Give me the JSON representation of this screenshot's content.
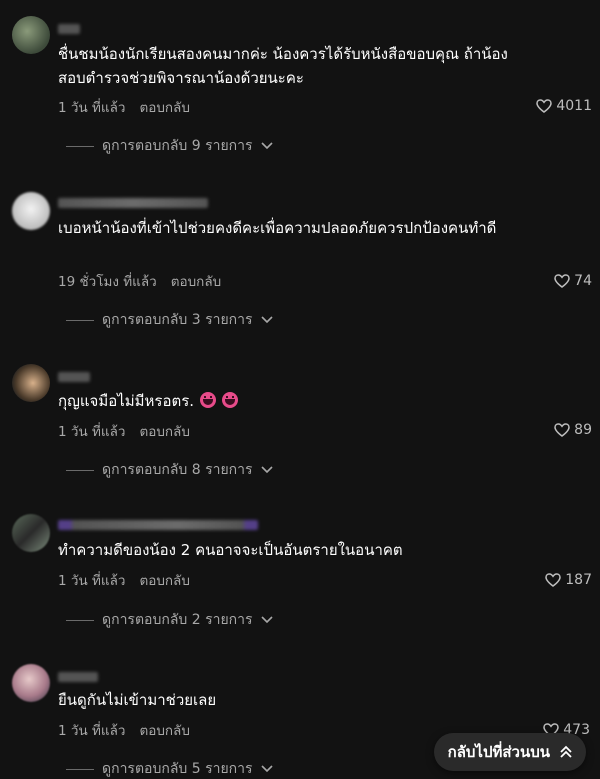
{
  "comments": [
    {
      "text": "ชื่นชมน้องนักเรียนสองคนมากค่ะ น้องควรได้รับหนังสือขอบคุณ ถ้าน้องสอบตำรวจช่วยพิจารณาน้องด้วยนะคะ",
      "time": "1 วัน ที่แล้ว",
      "reply_label": "ตอบกลับ",
      "likes": "4011",
      "view_replies": "ดูการตอบกลับ 9 รายการ"
    },
    {
      "text": "เบอหน้าน้องที่เข้าไปช่วยคงดีคะเพื่อความปลอดภัยควรปกป้องคนทำดี",
      "time": "19 ชั่วโมง ที่แล้ว",
      "reply_label": "ตอบกลับ",
      "likes": "74",
      "view_replies": "ดูการตอบกลับ 3 รายการ"
    },
    {
      "text": "กุญแจมือไม่มีหรอตร.",
      "time": "1 วัน ที่แล้ว",
      "reply_label": "ตอบกลับ",
      "likes": "89",
      "view_replies": "ดูการตอบกลับ 8 รายการ"
    },
    {
      "text": "ทำความดีของน้อง 2 คนอาจจะเป็นอันตรายในอนาคต",
      "time": "1 วัน ที่แล้ว",
      "reply_label": "ตอบกลับ",
      "likes": "187",
      "view_replies": "ดูการตอบกลับ 2 รายการ"
    },
    {
      "text": "ยืนดูกันไม่เข้ามาช่วยเลย",
      "time": "1 วัน ที่แล้ว",
      "reply_label": "ตอบกลับ",
      "likes": "473",
      "view_replies": "ดูการตอบกลับ 5 รายการ"
    }
  ],
  "back_to_top": "กลับไปที่ส่วนบน",
  "icons": {
    "like": "heart-outline-icon",
    "expand": "chevron-down-icon",
    "back_to_top": "double-chevron-up-icon",
    "emoji": "grinning-face-emoji"
  },
  "colors": {
    "background": "#121212",
    "text": "#ffffff",
    "muted": "#a8a8a8"
  }
}
